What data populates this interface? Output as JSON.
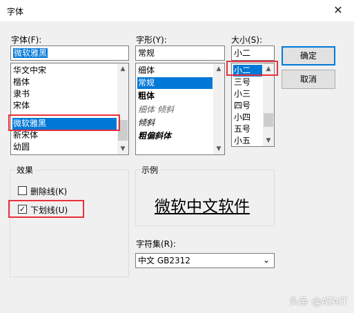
{
  "window": {
    "title": "字体",
    "close_glyph": "✕"
  },
  "font": {
    "label": "字体(F):",
    "value": "微软雅黑",
    "items": [
      "华文中宋",
      "楷体",
      "隶书",
      "宋体",
      "微软雅黑",
      "新宋体",
      "幼圆"
    ],
    "selected": "微软雅黑"
  },
  "style": {
    "label": "字形(Y):",
    "value": "常规",
    "items": [
      "细体",
      "常规",
      "粗体",
      "细体 倾斜",
      "倾斜",
      "粗偏斜体"
    ],
    "selected": "常规"
  },
  "size": {
    "label": "大小(S):",
    "value": "小二",
    "items": [
      "小二",
      "三号",
      "小三",
      "四号",
      "小四",
      "五号",
      "小五"
    ],
    "selected": "小二"
  },
  "buttons": {
    "ok": "确定",
    "cancel": "取消"
  },
  "effects": {
    "label": "效果",
    "strikeout": {
      "label": "删除线(K)",
      "checked": false
    },
    "underline": {
      "label": "下划线(U)",
      "checked": true,
      "check_glyph": "✓"
    }
  },
  "sample": {
    "label": "示例",
    "text": "微软中文软件"
  },
  "script": {
    "label": "字符集(R):",
    "value": "中文 GB2312",
    "arrow_glyph": "⌄"
  },
  "scroll_glyphs": {
    "up": "▲",
    "down": "▼"
  },
  "watermark": "头条 @ATAIT",
  "highlight_color": "#e8303a",
  "selection_color": "#0078d7"
}
